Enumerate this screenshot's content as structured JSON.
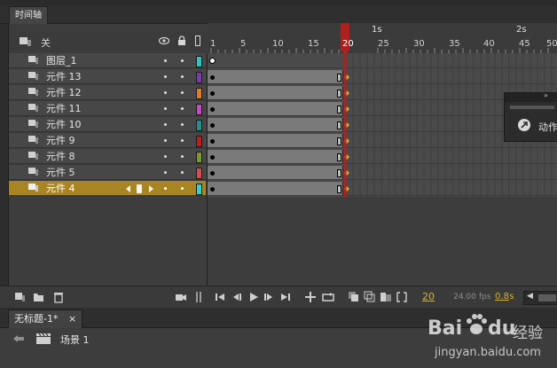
{
  "timeline_tab": {
    "label": "时间轴"
  },
  "layer_header": {
    "folder_label": "关"
  },
  "ruler": {
    "frame_ticks": [
      "1",
      "5",
      "10",
      "15",
      "20",
      "25",
      "30",
      "35",
      "40",
      "45",
      "50"
    ],
    "second_marks": [
      "1s",
      "2s"
    ],
    "current_frame": "20"
  },
  "layers": [
    {
      "name": "图层_1",
      "color": "#28c7c0",
      "selected": false
    },
    {
      "name": "元件 13",
      "color": "#7a3bb0",
      "selected": false
    },
    {
      "name": "元件 12",
      "color": "#e07d22",
      "selected": false
    },
    {
      "name": "元件 11",
      "color": "#c34bbd",
      "selected": false
    },
    {
      "name": "元件 10",
      "color": "#1f8f8c",
      "selected": false
    },
    {
      "name": "元件 9",
      "color": "#c21d1d",
      "selected": false
    },
    {
      "name": "元件 8",
      "color": "#7a9a2a",
      "selected": false
    },
    {
      "name": "元件 5",
      "color": "#d84c4c",
      "selected": false
    },
    {
      "name": "元件 4",
      "color": "#2fd6c8",
      "selected": true
    }
  ],
  "status": {
    "current_frame": "20",
    "fps": "24.00",
    "fps_unit": "fps",
    "seconds": "0.8",
    "seconds_unit": "s"
  },
  "actions_panel": {
    "label": "动作"
  },
  "document_tab": {
    "label": "无标题-1*",
    "close": "×"
  },
  "scene": {
    "label": "场景 1"
  },
  "watermark": {
    "brand": "Bai",
    "brand2": "du",
    "suffix": "经验",
    "url": "jingyan.baidu.com"
  },
  "colors": {
    "selection": "#a88422",
    "playhead": "#b11e1e",
    "accent_yellow": "#d8b22a"
  }
}
